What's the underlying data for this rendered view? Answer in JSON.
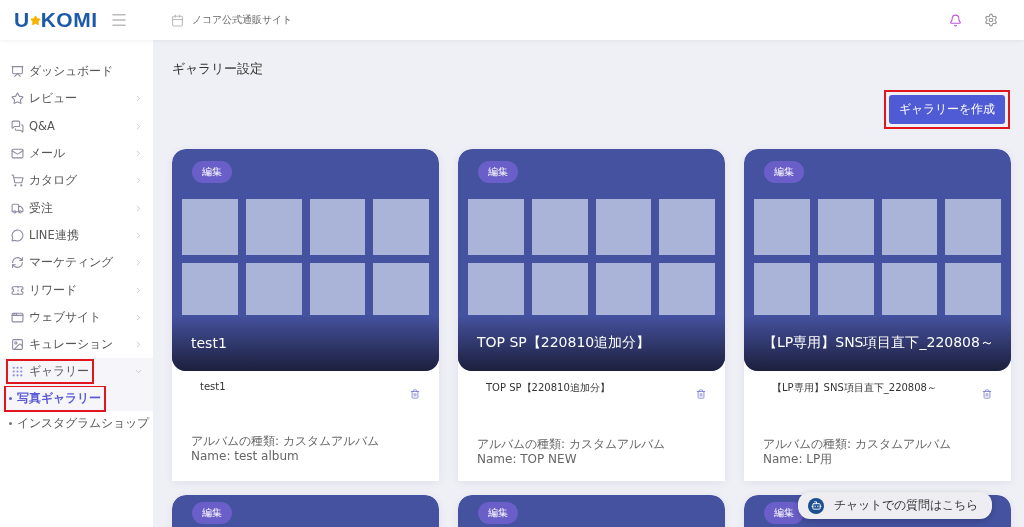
{
  "header": {
    "logo": {
      "left": "U",
      "right": "KOMI"
    },
    "site_name": "ノコア公式通販サイト"
  },
  "sidebar": {
    "items": [
      {
        "label": "ダッシュボード"
      },
      {
        "label": "レビュー",
        "expanded": false
      },
      {
        "label": "Q&A",
        "expanded": false
      },
      {
        "label": "メール",
        "expanded": false
      },
      {
        "label": "カタログ",
        "expanded": false
      },
      {
        "label": "受注",
        "expanded": false
      },
      {
        "label": "LINE連携",
        "expanded": false
      },
      {
        "label": "マーケティング",
        "expanded": false
      },
      {
        "label": "リワード",
        "expanded": false
      },
      {
        "label": "ウェブサイト",
        "expanded": false
      },
      {
        "label": "キュレーション",
        "expanded": false
      },
      {
        "label": "ギャラリー",
        "expanded": true,
        "highlighted": true,
        "children": [
          {
            "label": "写真ギャラリー",
            "selected": true,
            "highlighted": true
          },
          {
            "label": "インスタグラムショップ",
            "selected": false,
            "highlighted": false
          }
        ]
      }
    ]
  },
  "page": {
    "title": "ギャラリー設定",
    "create_button": {
      "label": "ギャラリーを作成",
      "highlighted": true
    }
  },
  "galleries": [
    {
      "edit": "編集",
      "title": "test1",
      "name": "test1",
      "album_type": "アルバムの種類: カスタムアルバム",
      "album_name": "Name: test album"
    },
    {
      "edit": "編集",
      "title": "TOP SP【220810追加分】",
      "name": "TOP SP【220810追加分】",
      "album_type": "アルバムの種類: カスタムアルバム",
      "album_name": "Name: TOP NEW"
    },
    {
      "edit": "編集",
      "title": "【LP専用】SNS項目直下_220808～",
      "name": "【LP専用】SNS項目直下_220808～",
      "album_type": "アルバムの種類: カスタムアルバム",
      "album_name": "Name: LP用"
    },
    {
      "edit": "編集"
    },
    {
      "edit": "編集"
    },
    {
      "edit": "編集"
    }
  ],
  "chat_button": {
    "label": "チャットでの質問はこちら"
  }
}
